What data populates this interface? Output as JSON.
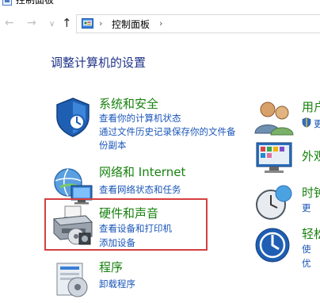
{
  "window": {
    "title": "控制面板"
  },
  "nav": {
    "back": "←",
    "forward": "→",
    "dropdown": "∨",
    "up": "↑",
    "address": {
      "separator": "›",
      "crumb": "控制面板",
      "trailing_separator": "›"
    }
  },
  "heading": "调整计算机的设置",
  "categories": [
    {
      "title": "系统和安全",
      "links": [
        "查看你的计算机状态",
        "通过文件历史记录保存你的文件备",
        "份副本"
      ],
      "icon": "shield-icon"
    },
    {
      "title": "网络和 Internet",
      "links": [
        "查看网络状态和任务"
      ],
      "icon": "network-icon"
    },
    {
      "title": "硬件和声音",
      "links": [
        "查看设备和打印机",
        "添加设备"
      ],
      "icon": "printer-icon"
    },
    {
      "title": "程序",
      "links": [
        "卸载程序"
      ],
      "icon": "programs-icon"
    }
  ],
  "right_categories": [
    {
      "title": "用户",
      "links": [
        "更"
      ],
      "icon": "users-icon"
    },
    {
      "title": "外观",
      "links": [],
      "icon": "appearance-icon"
    },
    {
      "title": "时钟",
      "links": [
        "更"
      ],
      "icon": "clock-icon"
    },
    {
      "title": "轻松",
      "links": [
        "使",
        "优"
      ],
      "icon": "ease-of-access-icon"
    }
  ],
  "colors": {
    "heading": "#1e3287",
    "category_title": "#18820f",
    "link": "#1a56b8",
    "highlight_border": "#d54040"
  }
}
